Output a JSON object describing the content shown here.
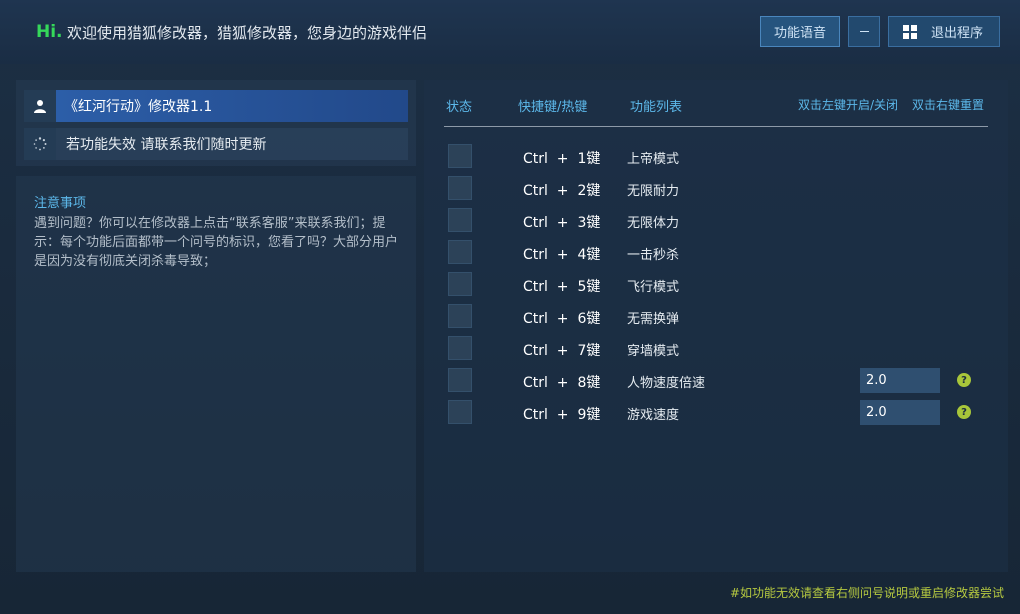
{
  "header": {
    "hi": "Hi.",
    "welcome": "欢迎使用猎狐修改器，猎狐修改器，您身边的游戏伴侣",
    "voice_button": "功能语音",
    "minimize_button": "—",
    "exit_button": "退出程序"
  },
  "left": {
    "game_title": "《红河行动》修改器1.1",
    "contact": "若功能失效  请联系我们随时更新",
    "notes_title": "注意事项",
    "notes_body": "遇到问题？你可以在修改器上点击“联系客服”来联系我们；提示：每个功能后面都带一个问号的标识，您看了吗？大部分用户是因为没有彻底关闭杀毒导致；"
  },
  "table": {
    "col_status": "状态",
    "col_hotkey": "快捷键/热键",
    "col_function": "功能列表",
    "toggle_hint": "双击左键开启/关闭",
    "reset_hint": "双击右键重置",
    "rows": [
      {
        "hotkey": "Ctrl  +  1键",
        "name": "上帝模式"
      },
      {
        "hotkey": "Ctrl  +  2键",
        "name": "无限耐力"
      },
      {
        "hotkey": "Ctrl  +  3键",
        "name": "无限体力"
      },
      {
        "hotkey": "Ctrl  +  4键",
        "name": "一击秒杀"
      },
      {
        "hotkey": "Ctrl  +  5键",
        "name": "飞行模式"
      },
      {
        "hotkey": "Ctrl  +  6键",
        "name": "无需换弹"
      },
      {
        "hotkey": "Ctrl  +  7键",
        "name": "穿墙模式"
      },
      {
        "hotkey": "Ctrl  +  8键",
        "name": "人物速度倍速",
        "value": "2.0",
        "help": "?"
      },
      {
        "hotkey": "Ctrl  +  9键",
        "name": "游戏速度",
        "value": "2.0",
        "help": "?"
      }
    ]
  },
  "footer": {
    "hint": "#如功能无效请查看右侧问号说明或重启修改器尝试"
  },
  "colors": {
    "accent_blue": "#5cb8ea",
    "hi_green": "#35d85a",
    "footer_green": "#b6c940",
    "help_icon": "#a8c63a"
  },
  "icons": {
    "user": "user-icon",
    "loading": "loading-icon",
    "windows": "windows-icon",
    "help": "help-icon"
  }
}
